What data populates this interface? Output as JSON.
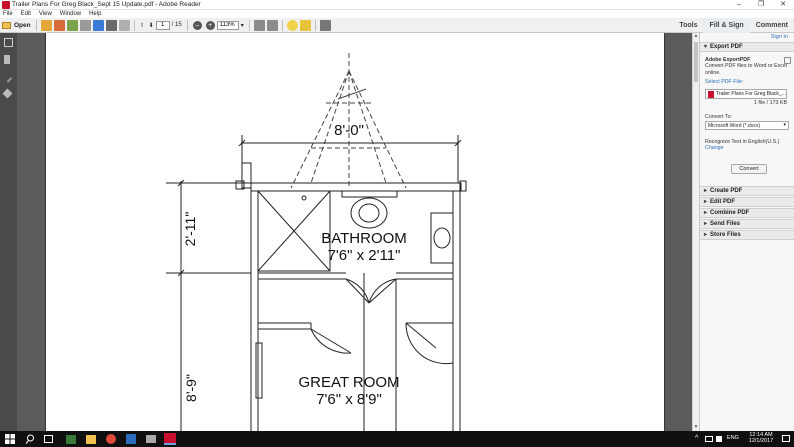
{
  "window": {
    "title": "Trailer Plans For Greg Black_Sept 15 Update.pdf - Adobe Reader",
    "minimize": "–",
    "maximize": "❐",
    "close": "✕"
  },
  "menu": [
    "File",
    "Edit",
    "View",
    "Window",
    "Help"
  ],
  "toolbar": {
    "open_label": "Open",
    "page_current": "1",
    "page_total": "/ 15",
    "zoom": "113%",
    "zoom_out": "–",
    "zoom_in": "+"
  },
  "right_nav": {
    "tools": "Tools",
    "fill_sign": "Fill & Sign",
    "comment": "Comment"
  },
  "drawing": {
    "dim_top": "8'-0\"",
    "dim_bath": "2'-11\"",
    "dim_great": "8'-9\"",
    "bath_label": "BATHROOM",
    "bath_size": "7'6\" x 2'11\"",
    "great_label": "GREAT ROOM",
    "great_size": "7'6\" x 8'9\""
  },
  "panel": {
    "sign_in": "Sign In",
    "export_header": "Export PDF",
    "export_title": "Adobe ExportPDF",
    "export_desc": "Convert PDF files to Word or Excel online.",
    "select_file": "Select PDF File:",
    "file_name": "Trailer Plans For Greg Black_...",
    "file_count": "1 file / 173 KB",
    "convert_to": "Convert To:",
    "format": "Microsoft Word (*.docx)",
    "recognize": "Recognize Text in English(U.S.)",
    "change": "Change",
    "convert_btn": "Convert",
    "sections": [
      "Create PDF",
      "Edit PDF",
      "Combine PDF",
      "Send Files",
      "Store Files"
    ]
  },
  "taskbar": {
    "lang": "ENG",
    "time": "12:14 AM",
    "date": "12/1/2017"
  }
}
